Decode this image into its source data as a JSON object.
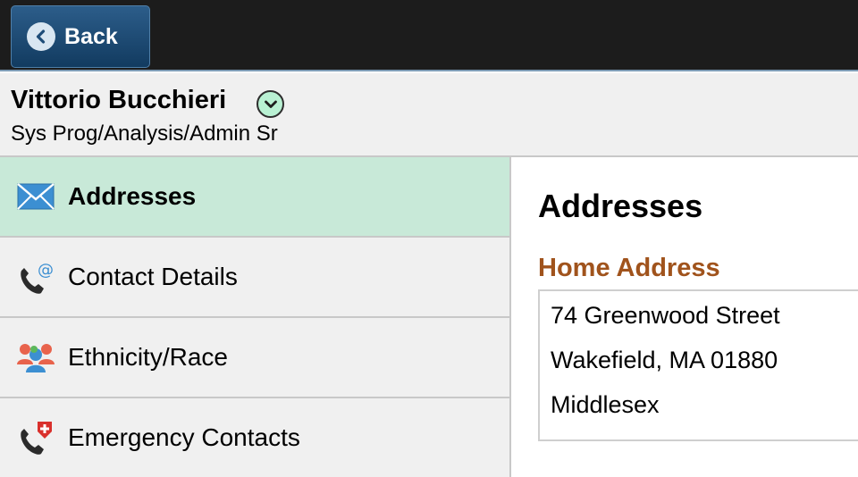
{
  "topbar": {
    "back_label": "Back",
    "bg_color": "#1c1c1c",
    "button_color": "#1f4d78"
  },
  "employee": {
    "name": "Vittorio Bucchieri",
    "title": "Sys Prog/Analysis/Admin Sr"
  },
  "sidebar": {
    "items": [
      {
        "label": "Addresses",
        "icon": "envelope-icon",
        "active": true
      },
      {
        "label": "Contact Details",
        "icon": "phone-at-icon",
        "active": false
      },
      {
        "label": "Ethnicity/Race",
        "icon": "people-icon",
        "active": false
      },
      {
        "label": "Emergency Contacts",
        "icon": "phone-emergency-icon",
        "active": false
      }
    ],
    "active_color": "#c8e9d8"
  },
  "main": {
    "title": "Addresses",
    "section_title": "Home Address",
    "section_color": "#a0531c",
    "address": [
      "74 Greenwood Street",
      "Wakefield, MA 01880",
      "Middlesex"
    ]
  }
}
